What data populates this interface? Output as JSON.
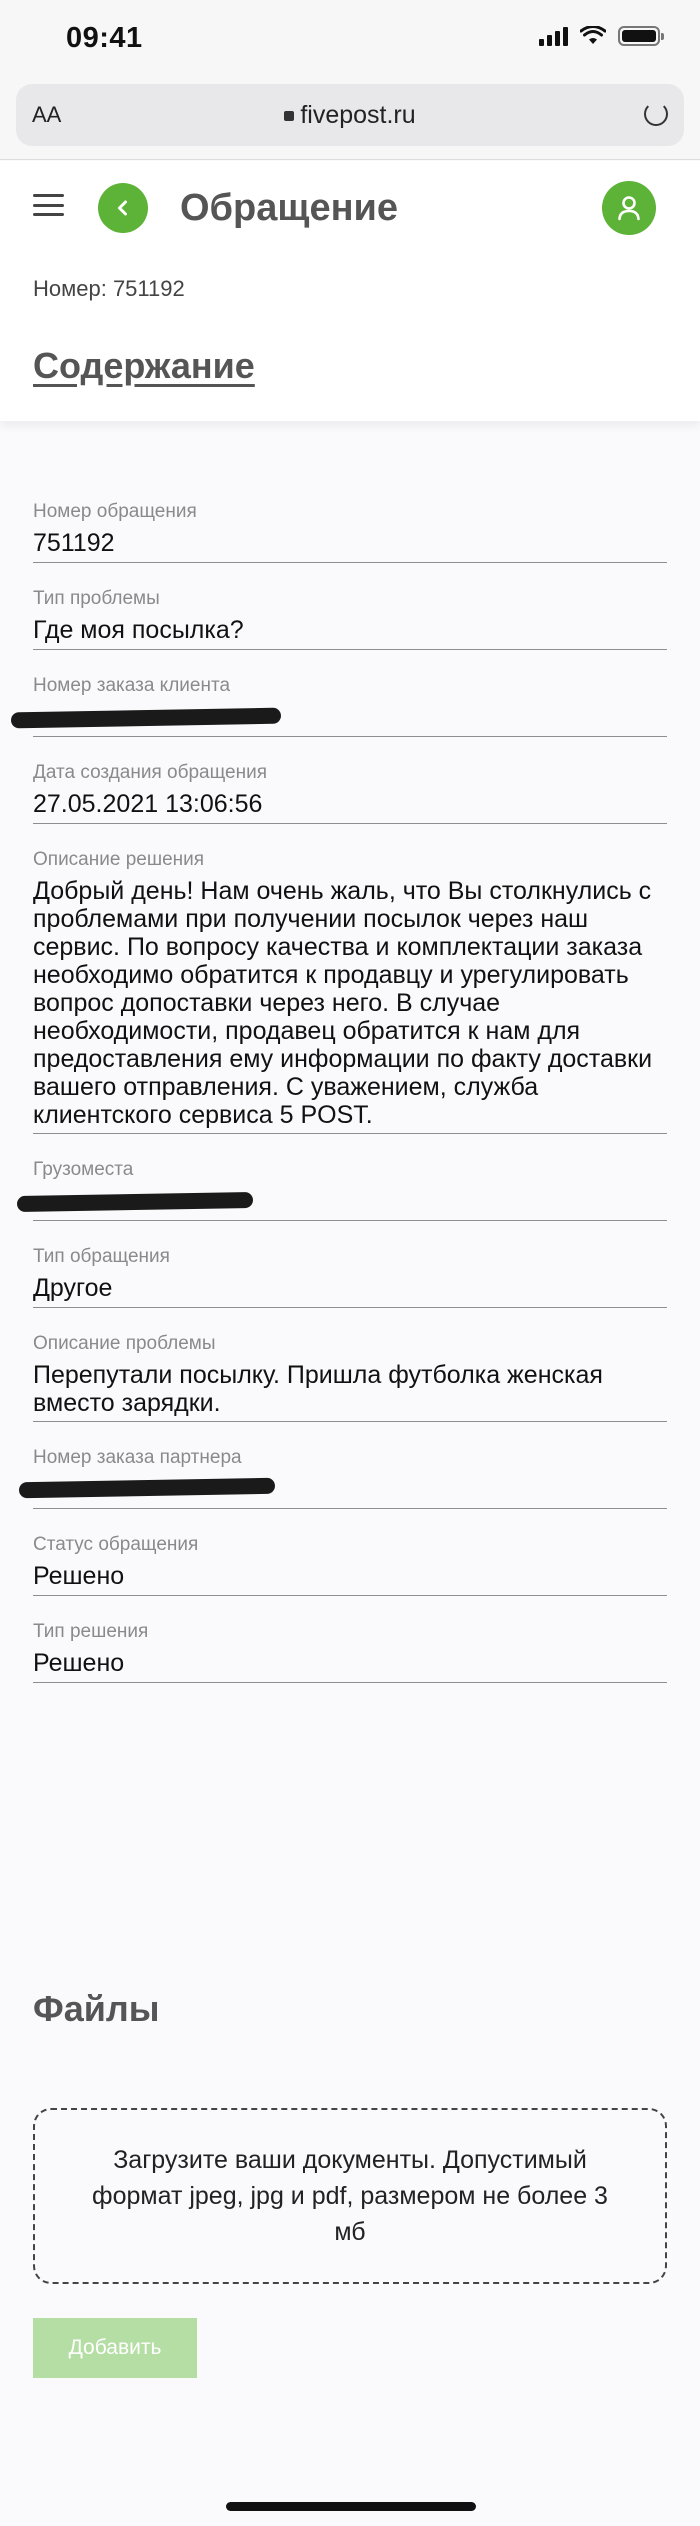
{
  "status_bar": {
    "time": "09:41"
  },
  "browser": {
    "text_size_label": "AA",
    "url": "fivepost.ru"
  },
  "header": {
    "title": "Обращение",
    "ticket_number": "Номер: 751192",
    "content_link": "Содержание"
  },
  "fields": [
    {
      "label": "Номер обращения",
      "value": "751192"
    },
    {
      "label": "Тип проблемы",
      "value": "Где моя посылка?"
    },
    {
      "label": "Номер заказа клиента",
      "value": ""
    },
    {
      "label": "Дата создания обращения",
      "value": "27.05.2021 13:06:56"
    },
    {
      "label": "Описание решения",
      "value": "Добрый день! Нам очень жаль, что Вы столкнулись с проблемами при получении посылок через наш сервис. По вопросу качества и комплектации заказа необходимо обратится к продавцу и урегулировать вопрос допоставки через него. В случае необходимости, продавец обратится к нам для предоставления ему информации по факту доставки вашего отправления. С уважением, служба клиентского сервиса 5 POST."
    },
    {
      "label": "Грузоместа",
      "value": ""
    },
    {
      "label": "Тип обращения",
      "value": "Другое"
    },
    {
      "label": "Описание проблемы",
      "value": "Перепутали посылку. Пришла футболка женская вместо зарядки."
    },
    {
      "label": "Номер заказа партнера",
      "value": ""
    },
    {
      "label": "Статус обращения",
      "value": "Решено"
    },
    {
      "label": "Тип решения",
      "value": "Решено"
    }
  ],
  "files": {
    "title": "Файлы",
    "upload_hint": "Загрузите ваши документы. Допустимый формат jpeg, jpg и pdf, размером не более 3 мб",
    "add_button": "Добавить"
  },
  "colors": {
    "brand_green": "#5cb338",
    "button_disabled": "#b5dea4",
    "muted_text": "#8a8a8a"
  }
}
